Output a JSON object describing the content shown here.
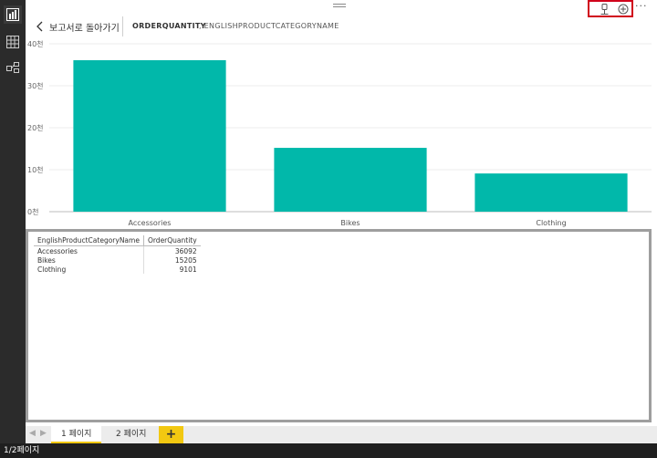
{
  "header": {
    "back_label": "보고서로 돌아가기",
    "measure": "ORDERQUANTITY",
    "axis": ", ENGLISHPRODUCTCATEGORYNAME"
  },
  "chart_data": {
    "type": "bar",
    "categories": [
      "Accessories",
      "Bikes",
      "Clothing"
    ],
    "values": [
      36092,
      15205,
      9101
    ],
    "ylim": [
      0,
      40000
    ],
    "yticks": [
      "0천",
      "10천",
      "20천",
      "30천",
      "40천"
    ],
    "ytick_values": [
      0,
      10000,
      20000,
      30000,
      40000
    ],
    "bar_color": "#01b8aa",
    "grid": true
  },
  "table": {
    "headers": [
      "EnglishProductCategoryName",
      "OrderQuantity"
    ],
    "rows": [
      [
        "Accessories",
        "36092"
      ],
      [
        "Bikes",
        "15205"
      ],
      [
        "Clothing",
        "9101"
      ]
    ]
  },
  "tabs": {
    "items": [
      "1 페이지",
      "2 페이지"
    ],
    "active_index": 0,
    "add_label": "+"
  },
  "status": {
    "page_indicator": "1/2페이지"
  },
  "colors": {
    "accent": "#f2c811",
    "highlight": "#d0021b",
    "rail": "#2b2b2b"
  },
  "icons": {
    "rail": [
      "report-icon",
      "data-icon",
      "relationships-icon"
    ],
    "top": [
      "pin-icon",
      "focus-icon",
      "more-icon"
    ]
  }
}
